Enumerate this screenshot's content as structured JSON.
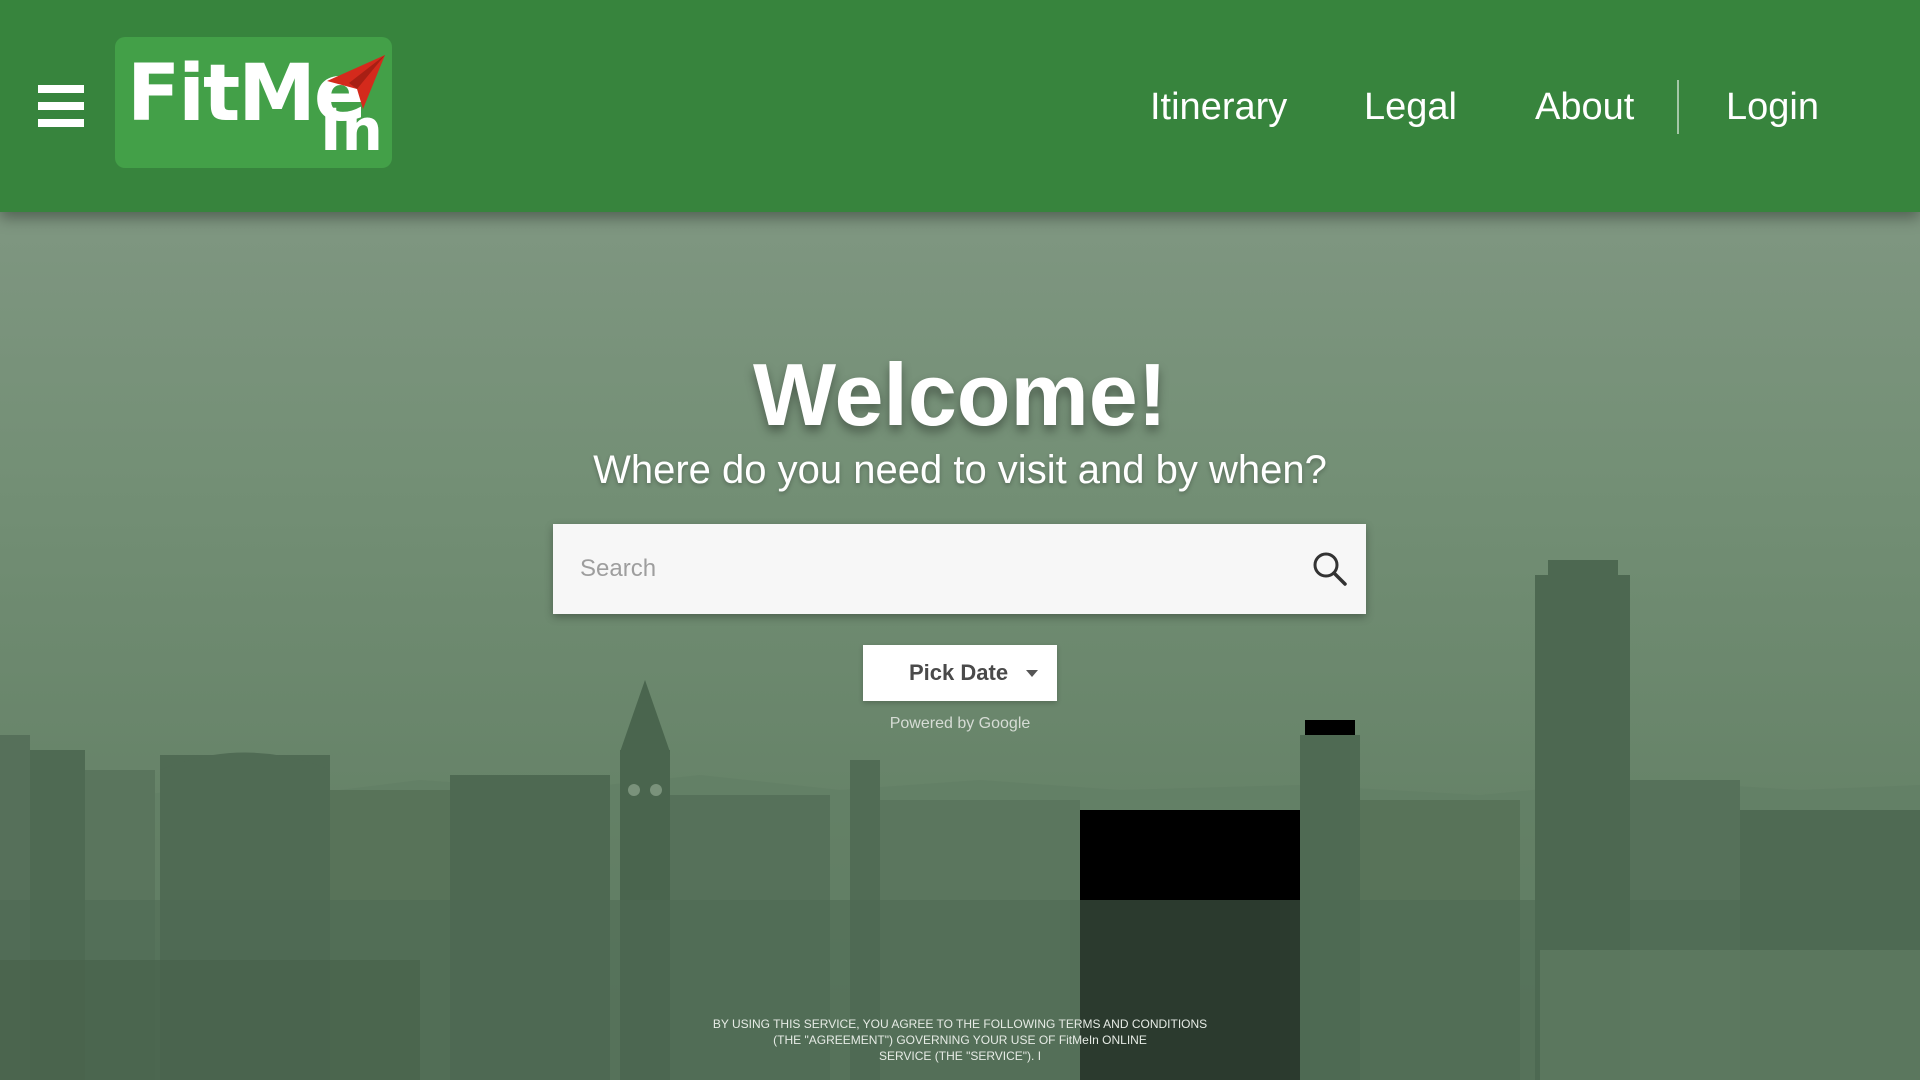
{
  "header": {
    "menu_icon": "hamburger-menu-icon",
    "logo": {
      "text_main": "FitMe",
      "text_sub": "In",
      "arrow_icon": "paper-plane-arrow-icon"
    },
    "nav": [
      {
        "label": "Itinerary"
      },
      {
        "label": "Legal"
      },
      {
        "label": "About"
      },
      {
        "label": "Login"
      }
    ]
  },
  "hero": {
    "title": "Welcome!",
    "subtitle": "Where do you need to visit and by when?"
  },
  "search": {
    "placeholder": "Search",
    "value": "",
    "icon": "search-icon"
  },
  "date_picker": {
    "label": "Pick Date",
    "icon": "caret-down-icon"
  },
  "powered_by": "Powered by Google",
  "terms": {
    "line1": "BY USING THIS SERVICE, YOU AGREE TO THE FOLLOWING TERMS AND CONDITIONS",
    "line2": "(THE \"AGREEMENT\") GOVERNING YOUR USE OF FitMeIn ONLINE",
    "line3": "SERVICE (THE \"SERVICE\"). I"
  },
  "colors": {
    "header": "#37843d",
    "logo_bg": "#43a048",
    "arrow": "#d42a1c",
    "overlay": "#6d8a6f"
  }
}
